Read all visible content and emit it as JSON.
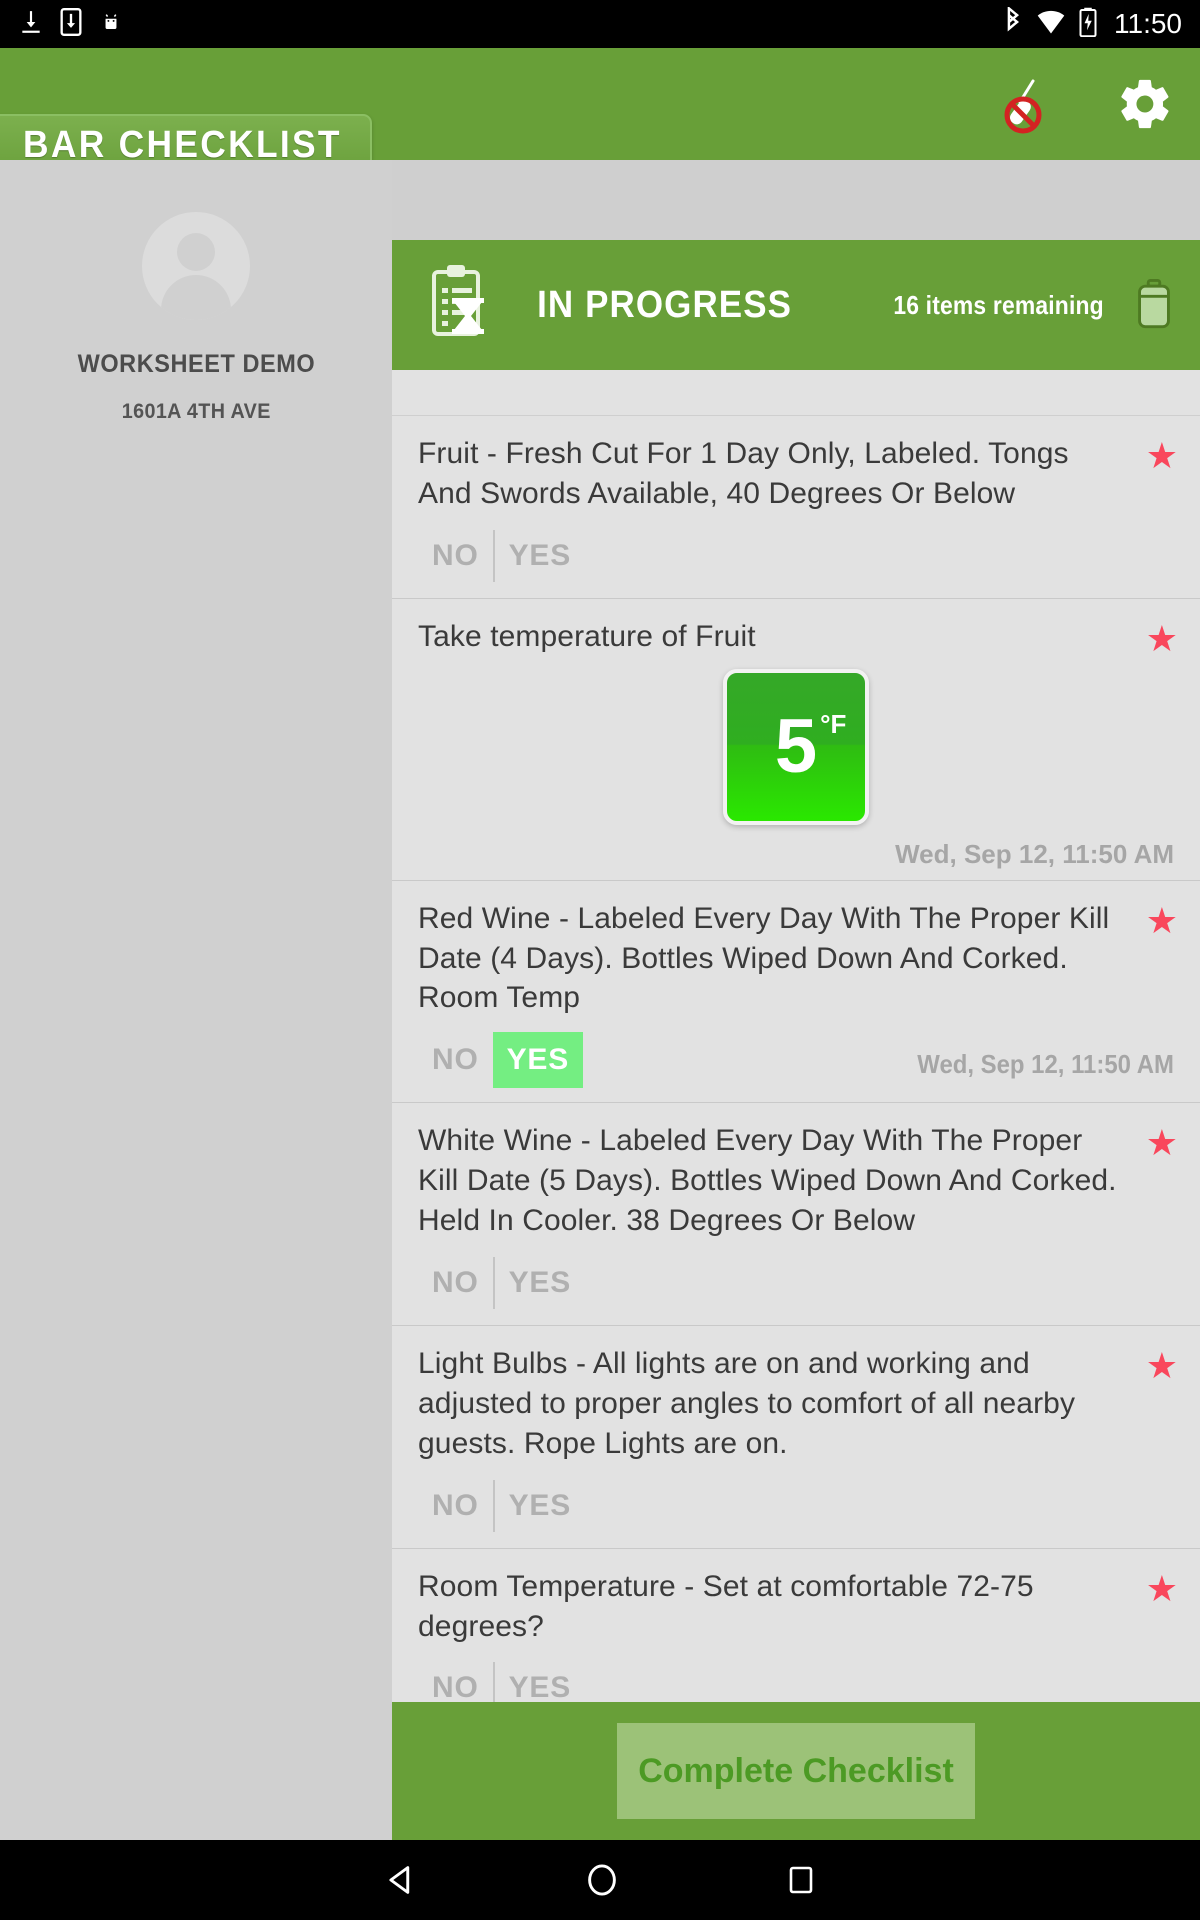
{
  "status_bar": {
    "time": "11:50",
    "icons_left": [
      "download-icon",
      "save-to-device-icon",
      "android-icon"
    ],
    "icons_right": [
      "bluetooth-icon",
      "wifi-icon",
      "battery-charging-icon"
    ]
  },
  "app_bar": {
    "title": "BAR CHECKLIST",
    "actions": [
      {
        "name": "no-thermometer-icon"
      },
      {
        "name": "settings-gear-icon"
      }
    ],
    "accent_color": "#689f38"
  },
  "sidebar": {
    "avatar": "default-avatar",
    "name": "WORKSHEET DEMO",
    "address": "1601A 4TH AVE"
  },
  "list_header": {
    "icon": "clipboard-hourglass-icon",
    "title": "IN PROGRESS",
    "remaining": "16 items remaining",
    "trash_icon": "trash-icon"
  },
  "items": [
    {
      "text": "Fruit - Fresh Cut For 1 Day Only, Labeled. Tongs And Swords Available, 40 Degrees Or Below",
      "type": "yes-no",
      "no_label": "NO",
      "yes_label": "YES",
      "selected": "",
      "starred": true,
      "star_color": "#f9475c",
      "timestamp": ""
    },
    {
      "text": "Take temperature of Fruit",
      "type": "temperature",
      "temp_value": "5",
      "temp_unit": "°F",
      "starred": true,
      "star_color": "#f9475c",
      "timestamp": "Wed, Sep 12, 11:50 AM"
    },
    {
      "text": "Red Wine - Labeled Every Day With The Proper Kill Date (4 Days). Bottles Wiped Down And Corked. Room Temp",
      "type": "yes-no",
      "no_label": "NO",
      "yes_label": "YES",
      "selected": "YES",
      "starred": true,
      "star_color": "#f9475c",
      "timestamp": "Wed, Sep 12, 11:50 AM"
    },
    {
      "text": "White Wine - Labeled Every Day With The Proper Kill Date (5 Days). Bottles Wiped Down And Corked. Held In Cooler. 38 Degrees Or Below",
      "type": "yes-no",
      "no_label": "NO",
      "yes_label": "YES",
      "selected": "",
      "starred": true,
      "star_color": "#f9475c",
      "timestamp": ""
    },
    {
      "text": "Light Bulbs - All lights are on and working and adjusted to proper angles to comfort of all nearby guests.  Rope Lights are on.",
      "type": "yes-no",
      "no_label": "NO",
      "yes_label": "YES",
      "selected": "",
      "starred": true,
      "star_color": "#f9475c",
      "timestamp": ""
    },
    {
      "text": "Room Temperature - Set at comfortable 72-75 degrees?",
      "type": "yes-no",
      "no_label": "NO",
      "yes_label": "YES",
      "selected": "",
      "starred": true,
      "star_color": "#f9475c",
      "timestamp": ""
    }
  ],
  "footer": {
    "complete_label": "Complete Checklist"
  },
  "nav_bar": {
    "back": "back-triangle-icon",
    "home": "home-circle-icon",
    "recents": "recents-square-icon"
  }
}
